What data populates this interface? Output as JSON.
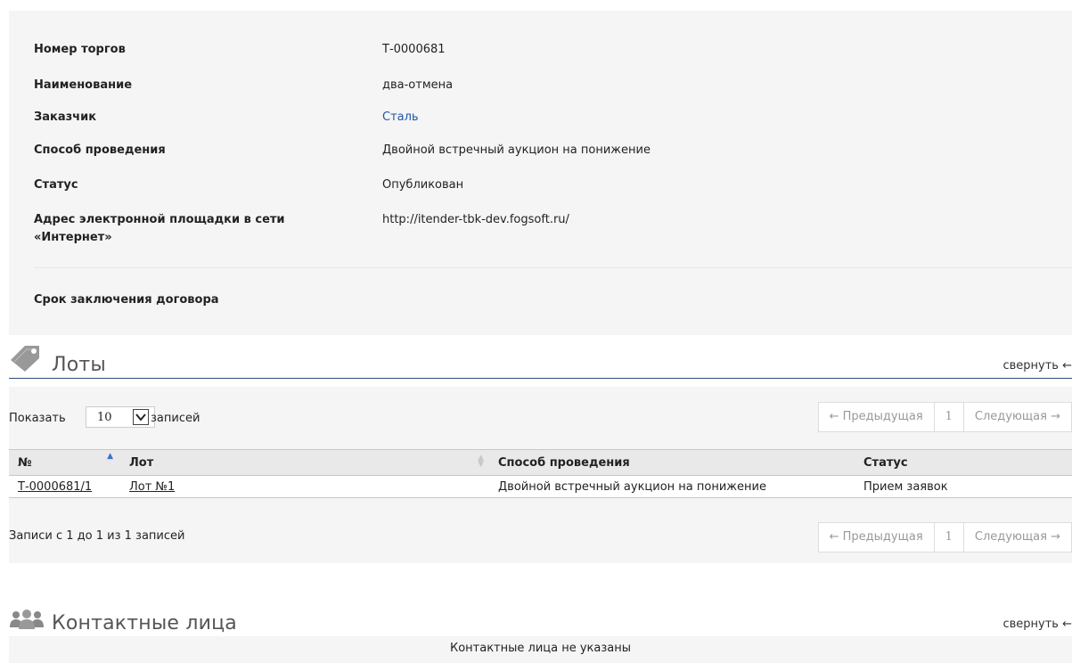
{
  "tender_info": {
    "rows": [
      {
        "label": "Номер торгов",
        "value": "Т-0000681"
      },
      {
        "label": "Наименование",
        "value": "два-отмена"
      },
      {
        "label": "Заказчик",
        "value": "Сталь"
      },
      {
        "label": "Способ проведения",
        "value": "Двойной встречный аукцион на понижение"
      },
      {
        "label": "Статус",
        "value": "Опубликован"
      },
      {
        "label": "Адрес электронной площадки в сети «Интернет»",
        "value": "http://itender-tbk-dev.fogsoft.ru/"
      }
    ],
    "contract_term_label": "Срок заключения договора"
  },
  "lots": {
    "title": "Лоты",
    "collapse_label": "свернуть ←",
    "icon": "tag-icon",
    "show_label": "Показать",
    "page_length": "10",
    "records_label": "записей",
    "pager": {
      "prev": "← Предыдущая",
      "page": "1",
      "next": "Следующая →"
    },
    "table": {
      "headers": [
        "№",
        "Лот",
        "Способ проведения",
        "Статус"
      ],
      "rows": [
        {
          "number": "Т-0000681/1",
          "lot": "Лот №1",
          "method": "Двойной встречный аукцион на понижение",
          "status": "Прием заявок"
        }
      ]
    },
    "info": "Записи с 1 до 1 из 1 записей"
  },
  "contacts": {
    "title": "Контактные лица",
    "collapse_label": "свернуть ←",
    "icon": "users-icon",
    "empty_text": "Контактные лица не указаны"
  },
  "colors": {
    "link": "#1f57a5",
    "rule": "#2f4a7d",
    "panel_bg": "#f5f5f5"
  }
}
